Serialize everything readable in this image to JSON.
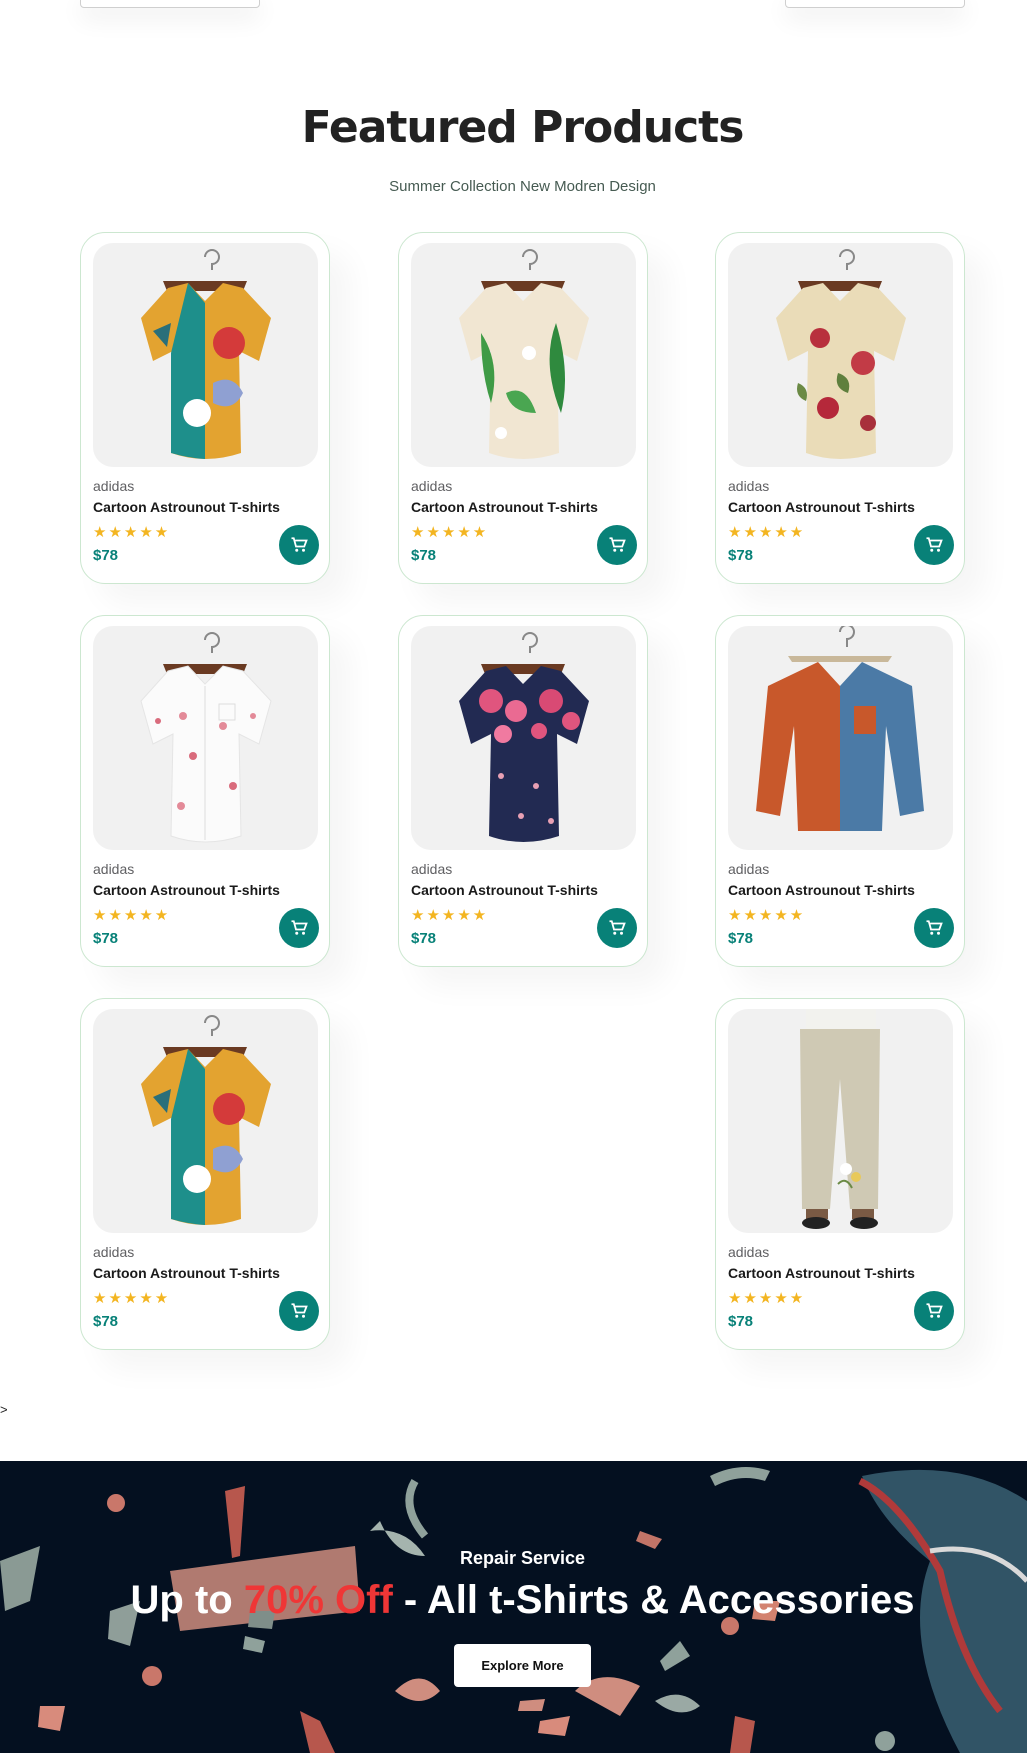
{
  "section": {
    "title": "Featured Products",
    "subtitle": "Summer Collection New Modren Design"
  },
  "products": [
    {
      "brand": "adidas",
      "name": "Cartoon Astrounout T-shirts",
      "stars": "★★★★★",
      "price": "$78",
      "image_icon": "shirt-colorful-pattern-icon"
    },
    {
      "brand": "adidas",
      "name": "Cartoon Astrounout T-shirts",
      "stars": "★★★★★",
      "price": "$78",
      "image_icon": "shirt-leaf-print-icon"
    },
    {
      "brand": "adidas",
      "name": "Cartoon Astrounout T-shirts",
      "stars": "★★★★★",
      "price": "$78",
      "image_icon": "shirt-floral-cream-icon"
    },
    {
      "brand": "adidas",
      "name": "Cartoon Astrounout T-shirts",
      "stars": "★★★★★",
      "price": "$78",
      "image_icon": "shirt-white-blossom-icon"
    },
    {
      "brand": "adidas",
      "name": "Cartoon Astrounout T-shirts",
      "stars": "★★★★★",
      "price": "$78",
      "image_icon": "shirt-navy-floral-icon"
    },
    {
      "brand": "adidas",
      "name": "Cartoon Astrounout T-shirts",
      "stars": "★★★★★",
      "price": "$78",
      "image_icon": "shirt-orange-blue-icon"
    },
    {
      "brand": "adidas",
      "name": "Cartoon Astrounout T-shirts",
      "stars": "★★★★★",
      "price": "$78",
      "image_icon": "shirt-colorful-pattern-icon"
    },
    {
      "brand": "adidas",
      "name": "Cartoon Astrounout T-shirts",
      "stars": "★★★★★",
      "price": "$78",
      "image_icon": "linen-trousers-icon"
    }
  ],
  "stray_text": ">",
  "banner": {
    "kicker": "Repair Service",
    "headline_prefix": "Up to ",
    "headline_accent": "70% Off",
    "headline_suffix": " - All t-Shirts & Accessories",
    "button_label": "Explore More"
  },
  "colors": {
    "accent": "#088178",
    "star": "#f3b521",
    "banner_bg": "#041020",
    "banner_accent": "#ef3636"
  }
}
